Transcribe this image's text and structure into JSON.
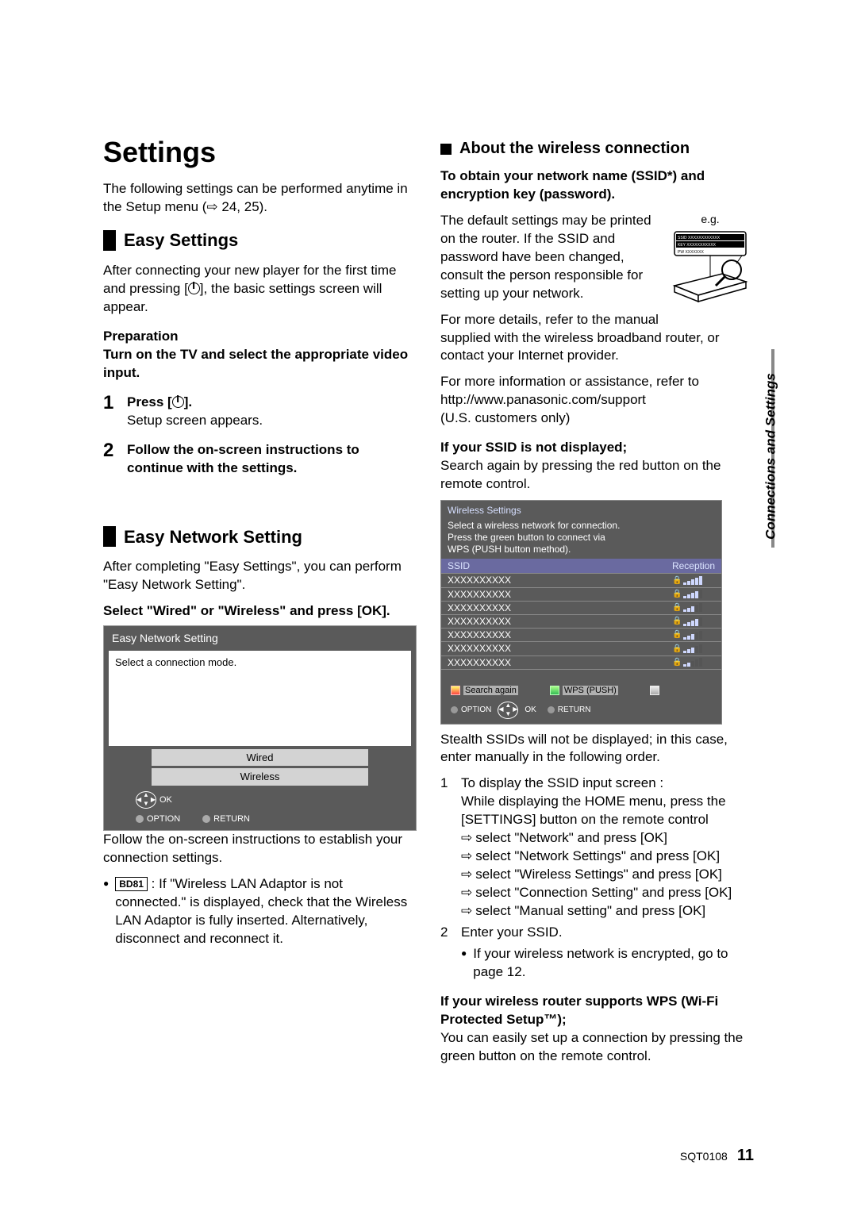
{
  "page": {
    "title": "Settings",
    "intro": "The following settings can be performed anytime in the Setup menu (⇨ 24, 25).",
    "footer_code": "SQT0108",
    "page_number": "11",
    "side_tab": "Connections and Settings"
  },
  "easy_settings": {
    "heading": "Easy Settings",
    "intro": "After connecting your new player for the first time and pressing [⏻], the basic settings screen will appear.",
    "prep_label": "Preparation",
    "prep_text": "Turn on the TV and select the appropriate video input.",
    "step1_num": "1",
    "step1_bold": "Press [⏻].",
    "step1_sub": "Setup screen appears.",
    "step2_num": "2",
    "step2_bold": "Follow the on-screen instructions to continue with the settings."
  },
  "easy_network": {
    "heading": "Easy Network Setting",
    "intro": "After completing \"Easy Settings\", you can perform \"Easy Network Setting\".",
    "select_bold": "Select \"Wired\" or \"Wireless\" and press [OK].",
    "box": {
      "title": "Easy Network Setting",
      "prompt": "Select a connection mode.",
      "opt_wired": "Wired",
      "opt_wireless": "Wireless",
      "ok": "OK",
      "option": "OPTION",
      "return": "RETURN"
    },
    "after_box": "Follow the on-screen instructions to establish your connection settings.",
    "bd81_badge": "BD81",
    "bd81_text": ": If \"Wireless LAN Adaptor is not connected.\" is displayed, check that the Wireless LAN Adaptor is fully inserted. Alternatively, disconnect and reconnect it."
  },
  "wireless": {
    "heading": "About the wireless connection",
    "ssid_heading": "To obtain your network name (SSID*) and encryption key (password).",
    "eg_label": "e.g.",
    "router_line1": "SSID XXXXXXXXXXXX",
    "router_line2": "KEY XXXXXXXXXXX",
    "router_line3": "PW XXXXXXX",
    "default_text": "The default settings may be printed on the router. If the SSID and password have been changed, consult the person responsible for setting up your network.",
    "more_details": "For more details, refer to the manual supplied with the wireless broadband router, or contact your Internet provider.",
    "more_info1": "For more information or assistance, refer to http://www.panasonic.com/support",
    "more_info2": "(U.S. customers only)",
    "not_displayed_heading": "If your SSID is not displayed;",
    "not_displayed_text": "Search again by pressing the red button on the remote control.",
    "wifi_box": {
      "title": "Wireless Settings",
      "desc1": "Select a wireless network for connection.",
      "desc2": "Press the green button to connect via",
      "desc3": "WPS (PUSH button method).",
      "hdr_ssid": "SSID",
      "hdr_rec": "Reception",
      "row": "XXXXXXXXXX",
      "search": "Search again",
      "wps": "WPS (PUSH)",
      "ok": "OK",
      "option": "OPTION",
      "return": "RETURN"
    },
    "stealth": "Stealth SSIDs will not be displayed; in this case, enter manually in the following order.",
    "steps": {
      "n1": "1",
      "s1": "To display the SSID input screen :",
      "s1a": "While displaying the HOME menu, press the [SETTINGS] button on the remote control",
      "s1b": "select \"Network\" and press [OK]",
      "s1c": "select \"Network Settings\" and press [OK]",
      "s1d": "select \"Wireless Settings\" and press [OK]",
      "s1e": "select \"Connection Setting\" and press [OK]",
      "s1f": "select \"Manual setting\" and press [OK]",
      "n2": "2",
      "s2": "Enter your SSID.",
      "s2a": "If your wireless network is encrypted, go to page 12."
    },
    "wps_heading": "If your wireless router supports WPS (Wi-Fi Protected Setup™);",
    "wps_text": "You can easily set up a connection by pressing the green button on the remote control."
  }
}
